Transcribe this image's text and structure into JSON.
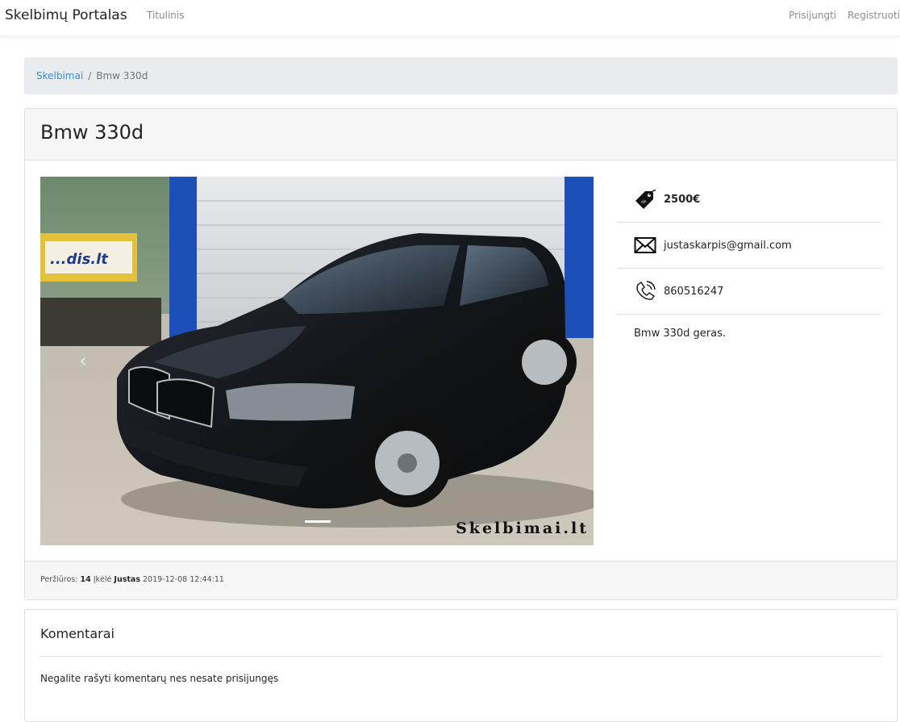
{
  "navbar": {
    "brand": "Skelbimų Portalas",
    "home": "Titulinis",
    "login": "Prisijungti",
    "register": "Registruoti"
  },
  "breadcrumb": {
    "parent": "Skelbimai",
    "separator": "/",
    "current": "Bmw 330d"
  },
  "listing": {
    "title": "Bmw 330d",
    "price": "2500€",
    "email": "justaskarpis@gmail.com",
    "phone": "860516247",
    "description": "Bmw 330d geras.",
    "image_watermark": "Skelbimai.lt",
    "carousel_prev": "‹",
    "icons": {
      "price": "price-tag-icon",
      "email": "envelope-icon",
      "phone": "phone-icon"
    }
  },
  "footer": {
    "views_label": "Peržiūros:",
    "views": "14",
    "uploaded_label": "Įkėlė",
    "author": "Justas",
    "date": "2019-12-08 12:44:11"
  },
  "comments": {
    "title": "Komentarai",
    "notice": "Negalite rašyti komentarų nes nesate prisijungęs"
  },
  "colors": {
    "link": "#3490dc",
    "breadcrumb_bg": "#e9ecef",
    "card_header_bg": "#f7f7f7"
  }
}
